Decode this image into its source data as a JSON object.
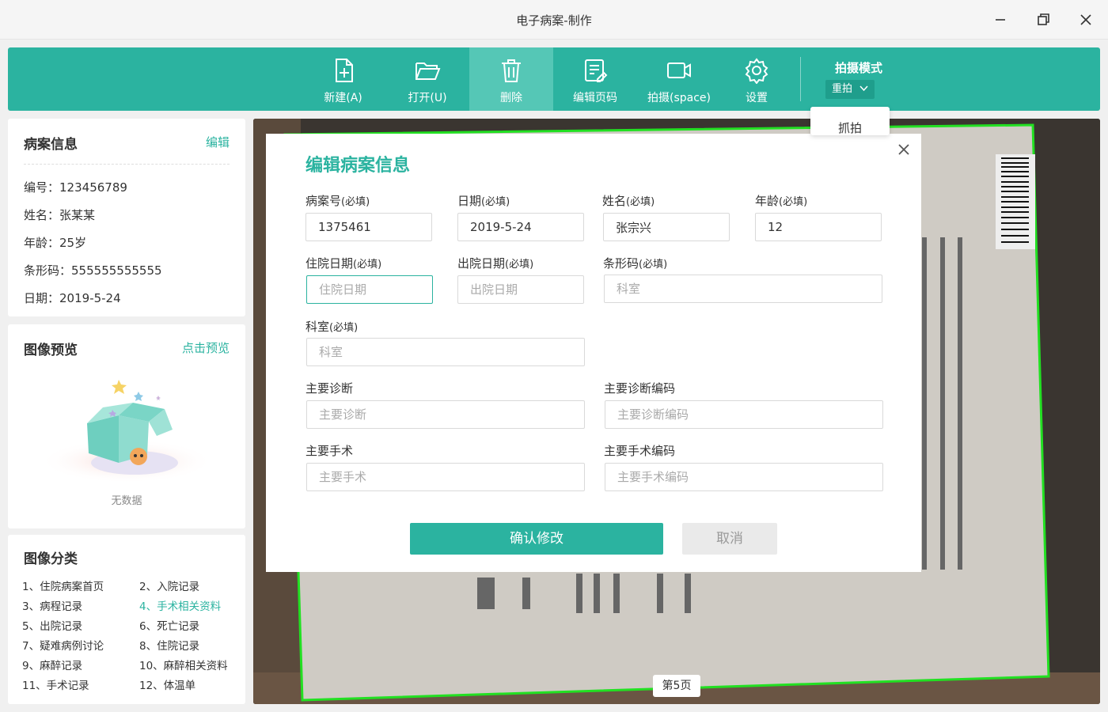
{
  "window": {
    "title": "电子病案-制作"
  },
  "toolbar": {
    "items": [
      {
        "label": "新建(A)",
        "icon": "new-file-icon"
      },
      {
        "label": "打开(U)",
        "icon": "open-folder-icon"
      },
      {
        "label": "删除",
        "icon": "trash-icon"
      },
      {
        "label": "编辑页码",
        "icon": "edit-page-icon"
      },
      {
        "label": "拍摄(space)",
        "icon": "camera-icon"
      },
      {
        "label": "设置",
        "icon": "gear-icon"
      }
    ],
    "mode": {
      "title": "拍摄模式",
      "selected": "重拍",
      "options": [
        "抓拍"
      ]
    }
  },
  "record_info": {
    "title": "病案信息",
    "edit_link": "编辑",
    "fields": [
      {
        "label": "编号：",
        "value": "123456789"
      },
      {
        "label": "姓名：",
        "value": "张某某"
      },
      {
        "label": "年龄：",
        "value": "25岁"
      },
      {
        "label": "条形码：",
        "value": "555555555555"
      },
      {
        "label": "日期：",
        "value": "2019-5-24"
      }
    ]
  },
  "preview": {
    "title": "图像预览",
    "link": "点击预览",
    "empty_text": "无数据"
  },
  "classification": {
    "title": "图像分类",
    "items": [
      "1、住院病案首页",
      "2、入院记录",
      "3、病程记录",
      "4、手术相关资料",
      "5、出院记录",
      "6、死亡记录",
      "7、疑难病例讨论",
      "8、住院记录",
      "9、麻醉记录",
      "10、麻醉相关资料",
      "11、手术记录",
      "12、体温单"
    ],
    "active_index": 3
  },
  "image_view": {
    "page_label": "第5页"
  },
  "modal": {
    "title": "编辑病案信息",
    "fields": {
      "case_no": {
        "label": "病案号",
        "req": "(必填)",
        "value": "1375461",
        "placeholder": ""
      },
      "date": {
        "label": "日期",
        "req": "(必填)",
        "value": "2019-5-24",
        "placeholder": ""
      },
      "name": {
        "label": "姓名",
        "req": "(必填)",
        "value": "张宗兴",
        "placeholder": ""
      },
      "age": {
        "label": "年龄",
        "req": "(必填)",
        "value": "12",
        "placeholder": ""
      },
      "admit_date": {
        "label": "住院日期",
        "req": "(必填)",
        "value": "",
        "placeholder": "住院日期"
      },
      "discharge_date": {
        "label": "出院日期",
        "req": "(必填)",
        "value": "",
        "placeholder": "出院日期"
      },
      "barcode": {
        "label": "条形码",
        "req": "(必填)",
        "value": "",
        "placeholder": "科室"
      },
      "department": {
        "label": "科室",
        "req": "(必填)",
        "value": "",
        "placeholder": "科室"
      },
      "diagnosis": {
        "label": "主要诊断",
        "req": "",
        "value": "",
        "placeholder": "主要诊断"
      },
      "diagnosis_code": {
        "label": "主要诊断编码",
        "req": "",
        "value": "",
        "placeholder": "主要诊断编码"
      },
      "surgery": {
        "label": "主要手术",
        "req": "",
        "value": "",
        "placeholder": "主要手术"
      },
      "surgery_code": {
        "label": "主要手术编码",
        "req": "",
        "value": "",
        "placeholder": "主要手术编码"
      }
    },
    "confirm_label": "确认修改",
    "cancel_label": "取消"
  },
  "colors": {
    "accent": "#2bb3a0",
    "accent_light": "#55c7b6",
    "detect_border": "#22e022"
  }
}
